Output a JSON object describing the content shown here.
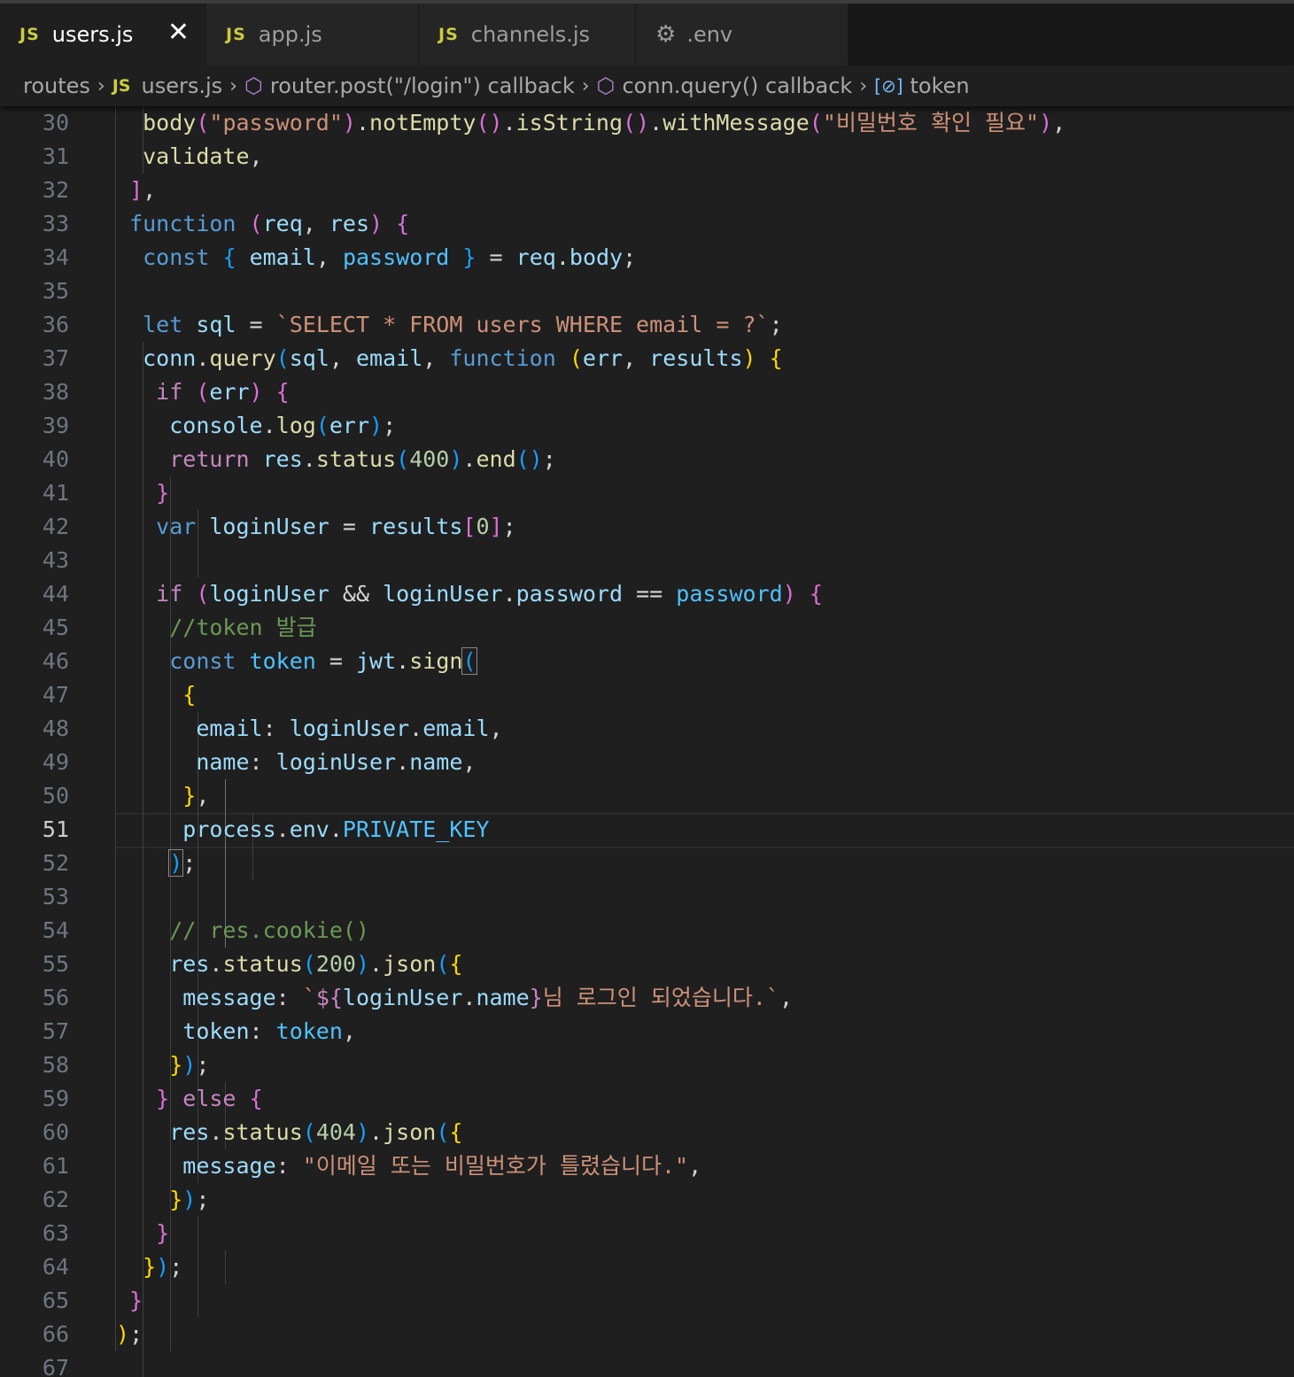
{
  "tabs": [
    {
      "icon": "JS",
      "label": "users.js",
      "active": true
    },
    {
      "icon": "JS",
      "label": "app.js"
    },
    {
      "icon": "JS",
      "label": "channels.js"
    },
    {
      "icon": "gear",
      "label": ".env"
    }
  ],
  "breadcrumb": {
    "folder": "routes",
    "file": "users.js",
    "symbol1": "router.post(\"/login\") callback",
    "symbol2": "conn.query() callback",
    "symbol3": "token"
  },
  "editor": {
    "current_line": 51,
    "line_numbers": [
      "30",
      "31",
      "32",
      "33",
      "34",
      "35",
      "36",
      "37",
      "38",
      "39",
      "40",
      "41",
      "42",
      "43",
      "44",
      "45",
      "46",
      "47",
      "48",
      "49",
      "50",
      "51",
      "52",
      "53",
      "54",
      "55",
      "56",
      "57",
      "58",
      "59",
      "60",
      "61",
      "62",
      "63",
      "64",
      "65",
      "66",
      "67"
    ],
    "code": {
      "l30": {
        "a": "body",
        "b": "(",
        "c": "\"password\"",
        "d": ")",
        "e": ".",
        "f": "notEmpty",
        "g": "()",
        "h": ".",
        "i": "isString",
        "j": "()",
        "k": ".",
        "l": "withMessage",
        "m": "(",
        "n": "\"비밀번호 확인 필요\"",
        "o": ")",
        ",": ","
      },
      "l31": {
        "a": "validate",
        "b": ","
      },
      "l32": {
        "a": "]",
        "b": ","
      },
      "l33": {
        "a": "function",
        "b": "(",
        "c": "req",
        "d": ", ",
        "e": "res",
        "f": ")",
        "g": "{"
      },
      "l34": {
        "a": "const",
        "b": "{",
        "c": "email",
        "d": ", ",
        "e": "password",
        "f": "}",
        "g": "=",
        "h": "req",
        "i": ".",
        "j": "body",
        "k": ";"
      },
      "l36": {
        "a": "let",
        "b": "sql",
        "c": "=",
        "d": "`SELECT * FROM users WHERE email = ?`",
        "e": ";"
      },
      "l37": {
        "a": "conn",
        "b": ".",
        "c": "query",
        "d": "(",
        "e": "sql",
        "f": ", ",
        "g": "email",
        "h": ", ",
        "i": "function",
        "j": "(",
        "k": "err",
        "l": ", ",
        "m": "results",
        "n": ")",
        "o": "{"
      },
      "l38": {
        "a": "if",
        "b": "(",
        "c": "err",
        "d": ")",
        "e": "{"
      },
      "l39": {
        "a": "console",
        "b": ".",
        "c": "log",
        "d": "(",
        "e": "err",
        "f": ")",
        "g": ";"
      },
      "l40": {
        "a": "return",
        "b": "res",
        "c": ".",
        "d": "status",
        "e": "(",
        "f": "400",
        "g": ")",
        "h": ".",
        "i": "end",
        "j": "()",
        "k": ";"
      },
      "l41": {
        "a": "}"
      },
      "l42": {
        "a": "var",
        "b": "loginUser",
        "c": "=",
        "d": "results",
        "e": "[",
        "f": "0",
        "g": "]",
        "h": ";"
      },
      "l44": {
        "a": "if",
        "b": "(",
        "c": "loginUser",
        "d": "&&",
        "e": "loginUser",
        "f": ".",
        "g": "password",
        "h": "==",
        "i": "password",
        "j": ")",
        "k": "{"
      },
      "l45": {
        "a": "//token 발급"
      },
      "l46": {
        "a": "const",
        "b": "token",
        "c": "=",
        "d": "jwt",
        "e": ".",
        "f": "sign",
        "g": "("
      },
      "l47": {
        "a": "{"
      },
      "l48": {
        "a": "email",
        "b": ":",
        "c": "loginUser",
        "d": ".",
        "e": "email",
        "f": ","
      },
      "l49": {
        "a": "name",
        "b": ":",
        "c": "loginUser",
        "d": ".",
        "e": "name",
        "f": ","
      },
      "l50": {
        "a": "}",
        "b": ","
      },
      "l51": {
        "a": "process",
        "b": ".",
        "c": "env",
        "d": ".",
        "e": "PRIVATE_KEY"
      },
      "l52": {
        "a": ")",
        "b": ";"
      },
      "l54": {
        "a": "// res.cookie()"
      },
      "l55": {
        "a": "res",
        "b": ".",
        "c": "status",
        "d": "(",
        "e": "200",
        "f": ")",
        "g": ".",
        "h": "json",
        "i": "(",
        "j": "{"
      },
      "l56": {
        "a": "message",
        "b": ":",
        "c": "`",
        "d": "${",
        "e": "loginUser",
        "f": ".",
        "g": "name",
        "h": "}",
        "i": "님 로그인 되었습니다.`",
        "j": ","
      },
      "l57": {
        "a": "token",
        "b": ":",
        "c": "token",
        "d": ","
      },
      "l58": {
        "a": "}",
        "b": ")",
        "c": ";"
      },
      "l59": {
        "a": "}",
        "b": "else",
        "c": "{"
      },
      "l60": {
        "a": "res",
        "b": ".",
        "c": "status",
        "d": "(",
        "e": "404",
        "f": ")",
        "g": ".",
        "h": "json",
        "i": "(",
        "j": "{"
      },
      "l61": {
        "a": "message",
        "b": ":",
        "c": "\"이메일 또는 비밀번호가 틀렸습니다.\"",
        "d": ","
      },
      "l62": {
        "a": "}",
        "b": ")",
        "c": ";"
      },
      "l63": {
        "a": "}"
      },
      "l64": {
        "a": "}",
        "b": ")",
        "c": ";"
      },
      "l65": {
        "a": "}"
      },
      "l66": {
        "a": ")",
        "b": ";"
      }
    }
  }
}
